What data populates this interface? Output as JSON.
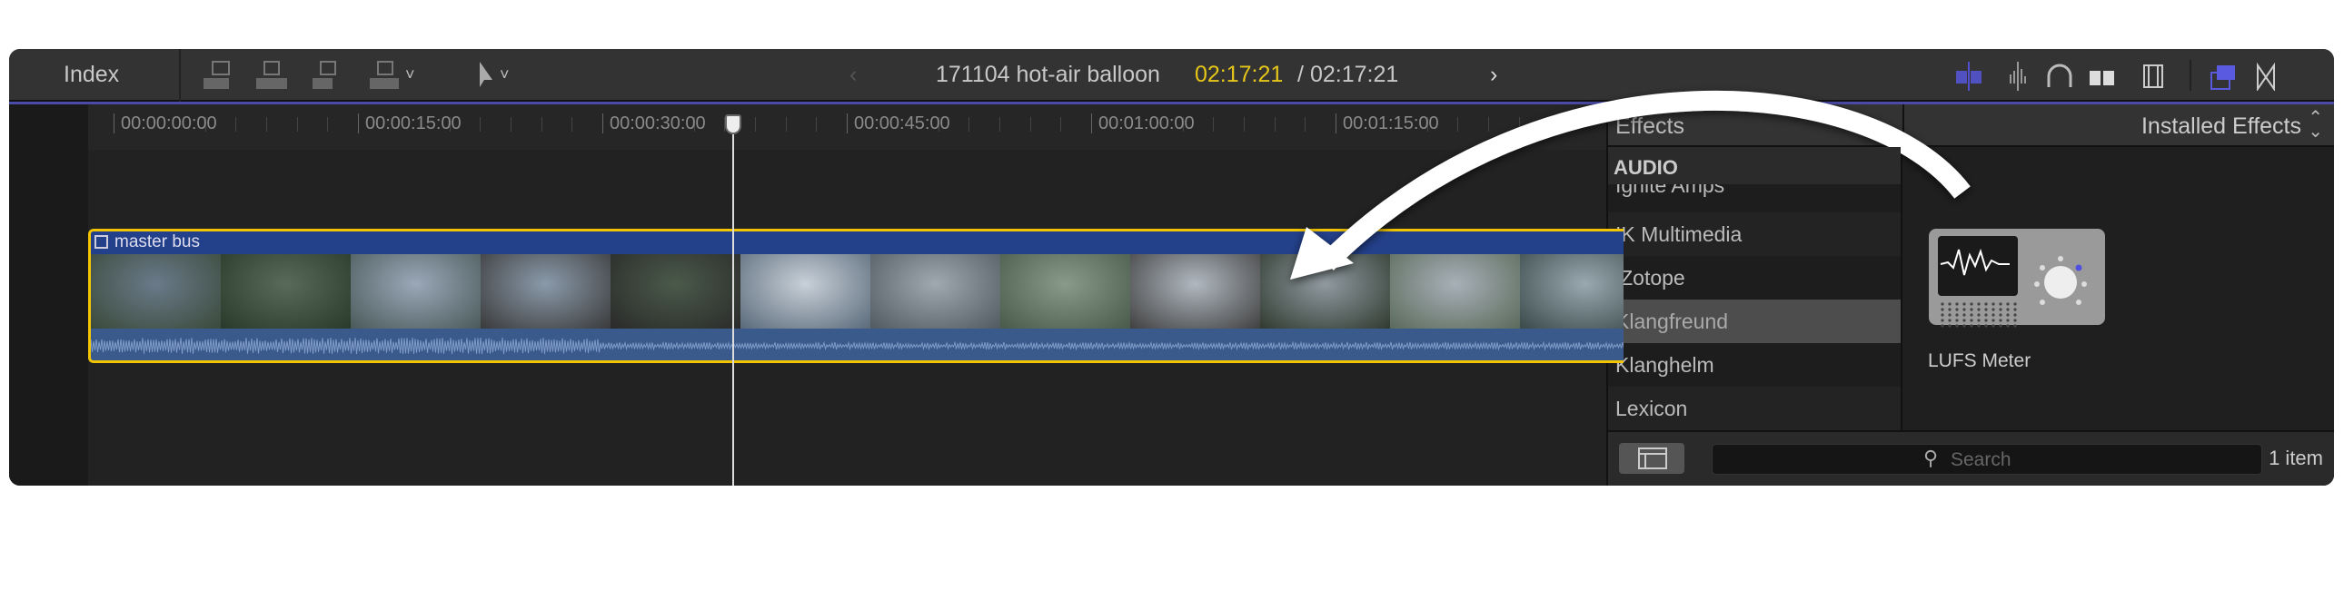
{
  "toolbar": {
    "index_label": "Index",
    "project_title": "171104 hot-air balloon",
    "timecode_current": "02:17:21",
    "timecode_separator": "/",
    "timecode_total": "02:17:21",
    "accent": "#5050d0",
    "current_color": "#e6c619"
  },
  "ruler": {
    "timecodes": [
      "00:00:00:00",
      "00:00:15:00",
      "00:00:30:00",
      "00:00:45:00",
      "00:01:00:00",
      "00:01:15:00"
    ]
  },
  "clip": {
    "name": "master bus"
  },
  "effects": {
    "title": "Effects",
    "selector": "Installed Effects",
    "section": "AUDIO",
    "categories": [
      "Ignite Amps",
      "IK Multimedia",
      "iZotope",
      "Klangfreund",
      "Klanghelm",
      "Lexicon"
    ],
    "selected": "Klangfreund",
    "items": [
      {
        "name": "LUFS Meter"
      }
    ],
    "search_placeholder": "Search",
    "count": "1 item"
  }
}
